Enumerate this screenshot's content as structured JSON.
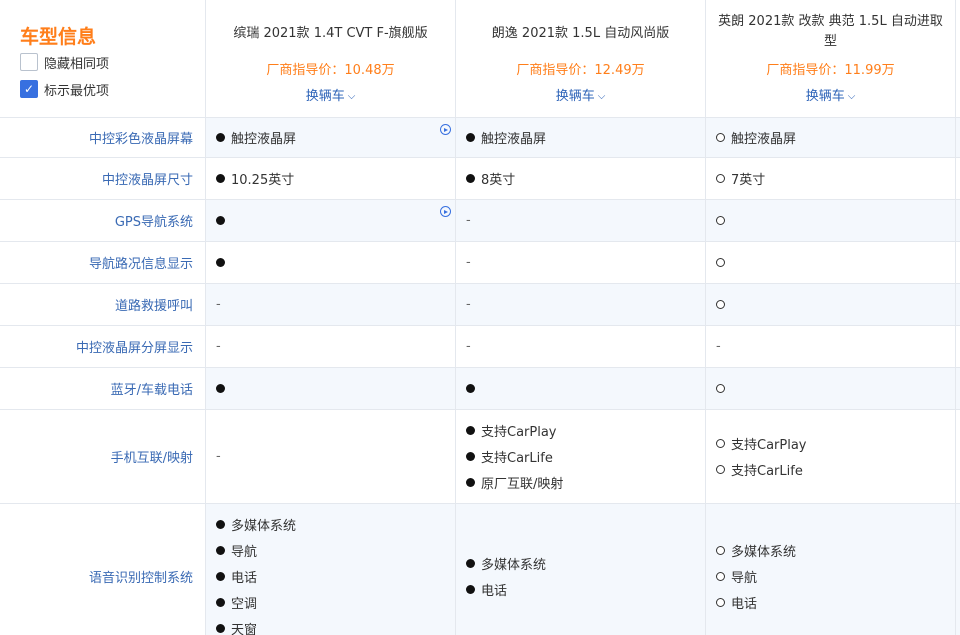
{
  "header": {
    "title": "车型信息",
    "options": [
      {
        "label": "隐藏相同项",
        "checked": false
      },
      {
        "label": "标示最优项",
        "checked": true
      }
    ],
    "cars": [
      {
        "name": "缤瑞 2021款 1.4T CVT F-旗舰版",
        "price": "厂商指导价：10.48万",
        "swap": "换辆车"
      },
      {
        "name": "朗逸 2021款 1.5L 自动风尚版",
        "price": "厂商指导价：12.49万",
        "swap": "换辆车"
      },
      {
        "name": "英朗 2021款 改款 典范 1.5L 自动进取型",
        "price": "厂商指导价：11.99万",
        "swap": "换辆车"
      }
    ],
    "check_mark": "✓",
    "chevron": "⌵"
  },
  "rows": [
    {
      "label": "中控彩色液晶屏幕",
      "height": 40,
      "alt": true,
      "play": [
        true,
        false,
        false
      ],
      "cells": [
        [
          {
            "t": "s",
            "v": "触控液晶屏"
          }
        ],
        [
          {
            "t": "s",
            "v": "触控液晶屏"
          }
        ],
        [
          {
            "t": "o",
            "v": "触控液晶屏"
          }
        ]
      ]
    },
    {
      "label": "中控液晶屏尺寸",
      "height": 42,
      "alt": false,
      "play": [
        false,
        false,
        false
      ],
      "cells": [
        [
          {
            "t": "s",
            "v": "10.25英寸"
          }
        ],
        [
          {
            "t": "s",
            "v": "8英寸"
          }
        ],
        [
          {
            "t": "o",
            "v": "7英寸"
          }
        ]
      ]
    },
    {
      "label": "GPS导航系统",
      "height": 42,
      "alt": true,
      "play": [
        true,
        false,
        false
      ],
      "cells": [
        [
          {
            "t": "s",
            "v": ""
          }
        ],
        [
          {
            "t": "n",
            "v": "-"
          }
        ],
        [
          {
            "t": "o",
            "v": ""
          }
        ]
      ]
    },
    {
      "label": "导航路况信息显示",
      "height": 42,
      "alt": false,
      "play": [
        false,
        false,
        false
      ],
      "cells": [
        [
          {
            "t": "s",
            "v": ""
          }
        ],
        [
          {
            "t": "n",
            "v": "-"
          }
        ],
        [
          {
            "t": "o",
            "v": ""
          }
        ]
      ]
    },
    {
      "label": "道路救援呼叫",
      "height": 42,
      "alt": true,
      "play": [
        false,
        false,
        false
      ],
      "cells": [
        [
          {
            "t": "n",
            "v": "-"
          }
        ],
        [
          {
            "t": "n",
            "v": "-"
          }
        ],
        [
          {
            "t": "o",
            "v": ""
          }
        ]
      ]
    },
    {
      "label": "中控液晶屏分屏显示",
      "height": 42,
      "alt": false,
      "play": [
        false,
        false,
        false
      ],
      "cells": [
        [
          {
            "t": "n",
            "v": "-"
          }
        ],
        [
          {
            "t": "n",
            "v": "-"
          }
        ],
        [
          {
            "t": "n",
            "v": "-"
          }
        ]
      ]
    },
    {
      "label": "蓝牙/车载电话",
      "height": 42,
      "alt": true,
      "play": [
        false,
        false,
        false
      ],
      "cells": [
        [
          {
            "t": "s",
            "v": ""
          }
        ],
        [
          {
            "t": "s",
            "v": ""
          }
        ],
        [
          {
            "t": "o",
            "v": ""
          }
        ]
      ]
    },
    {
      "label": "手机互联/映射",
      "height": 94,
      "alt": false,
      "play": [
        false,
        false,
        false
      ],
      "cells": [
        [
          {
            "t": "n",
            "v": "-"
          }
        ],
        [
          {
            "t": "s",
            "v": "支持CarPlay"
          },
          {
            "t": "s",
            "v": "支持CarLife"
          },
          {
            "t": "s",
            "v": "原厂互联/映射"
          }
        ],
        [
          {
            "t": "o",
            "v": "支持CarPlay"
          },
          {
            "t": "o",
            "v": "支持CarLife"
          }
        ]
      ]
    },
    {
      "label": "语音识别控制系统",
      "height": 145,
      "alt": true,
      "play": [
        false,
        false,
        false
      ],
      "cells": [
        [
          {
            "t": "s",
            "v": "多媒体系统"
          },
          {
            "t": "s",
            "v": "导航"
          },
          {
            "t": "s",
            "v": "电话"
          },
          {
            "t": "s",
            "v": "空调"
          },
          {
            "t": "s",
            "v": "天窗"
          }
        ],
        [
          {
            "t": "s",
            "v": "多媒体系统"
          },
          {
            "t": "s",
            "v": "电话"
          }
        ],
        [
          {
            "t": "o",
            "v": "多媒体系统"
          },
          {
            "t": "o",
            "v": "导航"
          },
          {
            "t": "o",
            "v": "电话"
          }
        ]
      ]
    }
  ]
}
